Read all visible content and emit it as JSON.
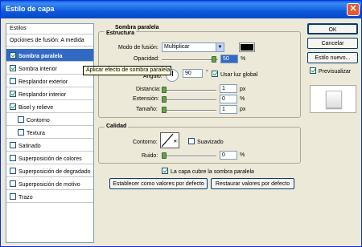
{
  "window": {
    "title": "Estilo de capa"
  },
  "left_panel": {
    "header": "Estilos",
    "subheader": "Opciones de fusión: A medida",
    "items": [
      {
        "label": "Sombra paralela",
        "checked": true,
        "selected": true
      },
      {
        "label": "Sombra interior",
        "checked": true,
        "selected": false
      },
      {
        "label": "Resplandor exterior",
        "checked": false,
        "selected": false
      },
      {
        "label": "Resplandor interior",
        "checked": true,
        "selected": false
      },
      {
        "label": "Bisel y relieve",
        "checked": true,
        "selected": false
      },
      {
        "label": "Contorno",
        "checked": false,
        "selected": false
      },
      {
        "label": "Textura",
        "checked": false,
        "selected": false
      },
      {
        "label": "Satinado",
        "checked": false,
        "selected": false
      },
      {
        "label": "Superposición de colores",
        "checked": false,
        "selected": false
      },
      {
        "label": "Superposición de degradado",
        "checked": false,
        "selected": false
      },
      {
        "label": "Superposición de motivo",
        "checked": false,
        "selected": false
      },
      {
        "label": "Trazo",
        "checked": false,
        "selected": false
      }
    ]
  },
  "tooltip": "Aplicar efecto de sombra paralela",
  "main": {
    "section_title": "Sombra paralela",
    "structure": {
      "title": "Estructura",
      "blend_mode_label": "Modo de fusión:",
      "blend_mode_value": "Multiplicar",
      "color": "#000000",
      "opacity_label": "Opacidad:",
      "opacity_value": "50",
      "opacity_unit": "%",
      "opacity_fraction": 0.5,
      "angle_label": "Ángulo:",
      "angle_value": "90",
      "angle_unit": "°",
      "global_light_label": "Usar luz global",
      "global_light_checked": true,
      "distance_label": "Distancia:",
      "distance_value": "1",
      "distance_unit": "px",
      "spread_label": "Extensión:",
      "spread_value": "0",
      "spread_unit": "%",
      "size_label": "Tamaño:",
      "size_value": "1",
      "size_unit": "px"
    },
    "quality": {
      "title": "Calidad",
      "contour_label": "Contorno:",
      "smooth_label": "Suavizado",
      "smooth_checked": false,
      "noise_label": "Ruido:",
      "noise_value": "0",
      "noise_unit": "%"
    },
    "knockout_label": "La capa cubre la sombra paralela",
    "knockout_checked": true,
    "set_default_button": "Establecer como valores por defecto",
    "reset_default_button": "Restaurar valores por defecto"
  },
  "right_panel": {
    "ok_button": "OK",
    "cancel_button": "Cancelar",
    "new_style_button": "Estilo nuevo...",
    "preview_label": "Previsualizar",
    "preview_checked": true
  }
}
